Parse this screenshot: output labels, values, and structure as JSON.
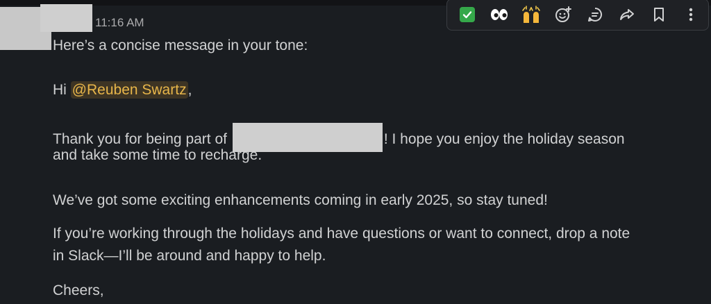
{
  "message": {
    "timestamp": "11:16 AM",
    "intro": "Here’s a concise message in your tone:",
    "greeting_prefix": "Hi ",
    "mention": "@Reuben Swartz",
    "greeting_suffix": ",",
    "thanks_prefix": "Thank you for being part of ",
    "thanks_suffix": "! I hope you enjoy the holiday season",
    "thanks_line2": "and take some time to recharge.",
    "enhancements": "We’ve got some exciting enhancements coming in early 2025, so stay tuned!",
    "holidays_line1": "If you’re working through the holidays and have questions or want to connect, drop a note",
    "holidays_line2": "in Slack—I’ll be around and happy to help.",
    "closing": "Cheers,"
  },
  "toolbar": {
    "actions": [
      "check-mark-reaction",
      "eyes-reaction",
      "raised-hands-reaction",
      "add-reaction",
      "reply-in-thread",
      "share-message",
      "save-for-later",
      "more-actions"
    ]
  },
  "colors": {
    "background": "#1a1d21",
    "text": "#d1d2d3",
    "mention_text": "#e8b64a",
    "mention_background": "#3d3424",
    "check_green": "#35a84a"
  }
}
